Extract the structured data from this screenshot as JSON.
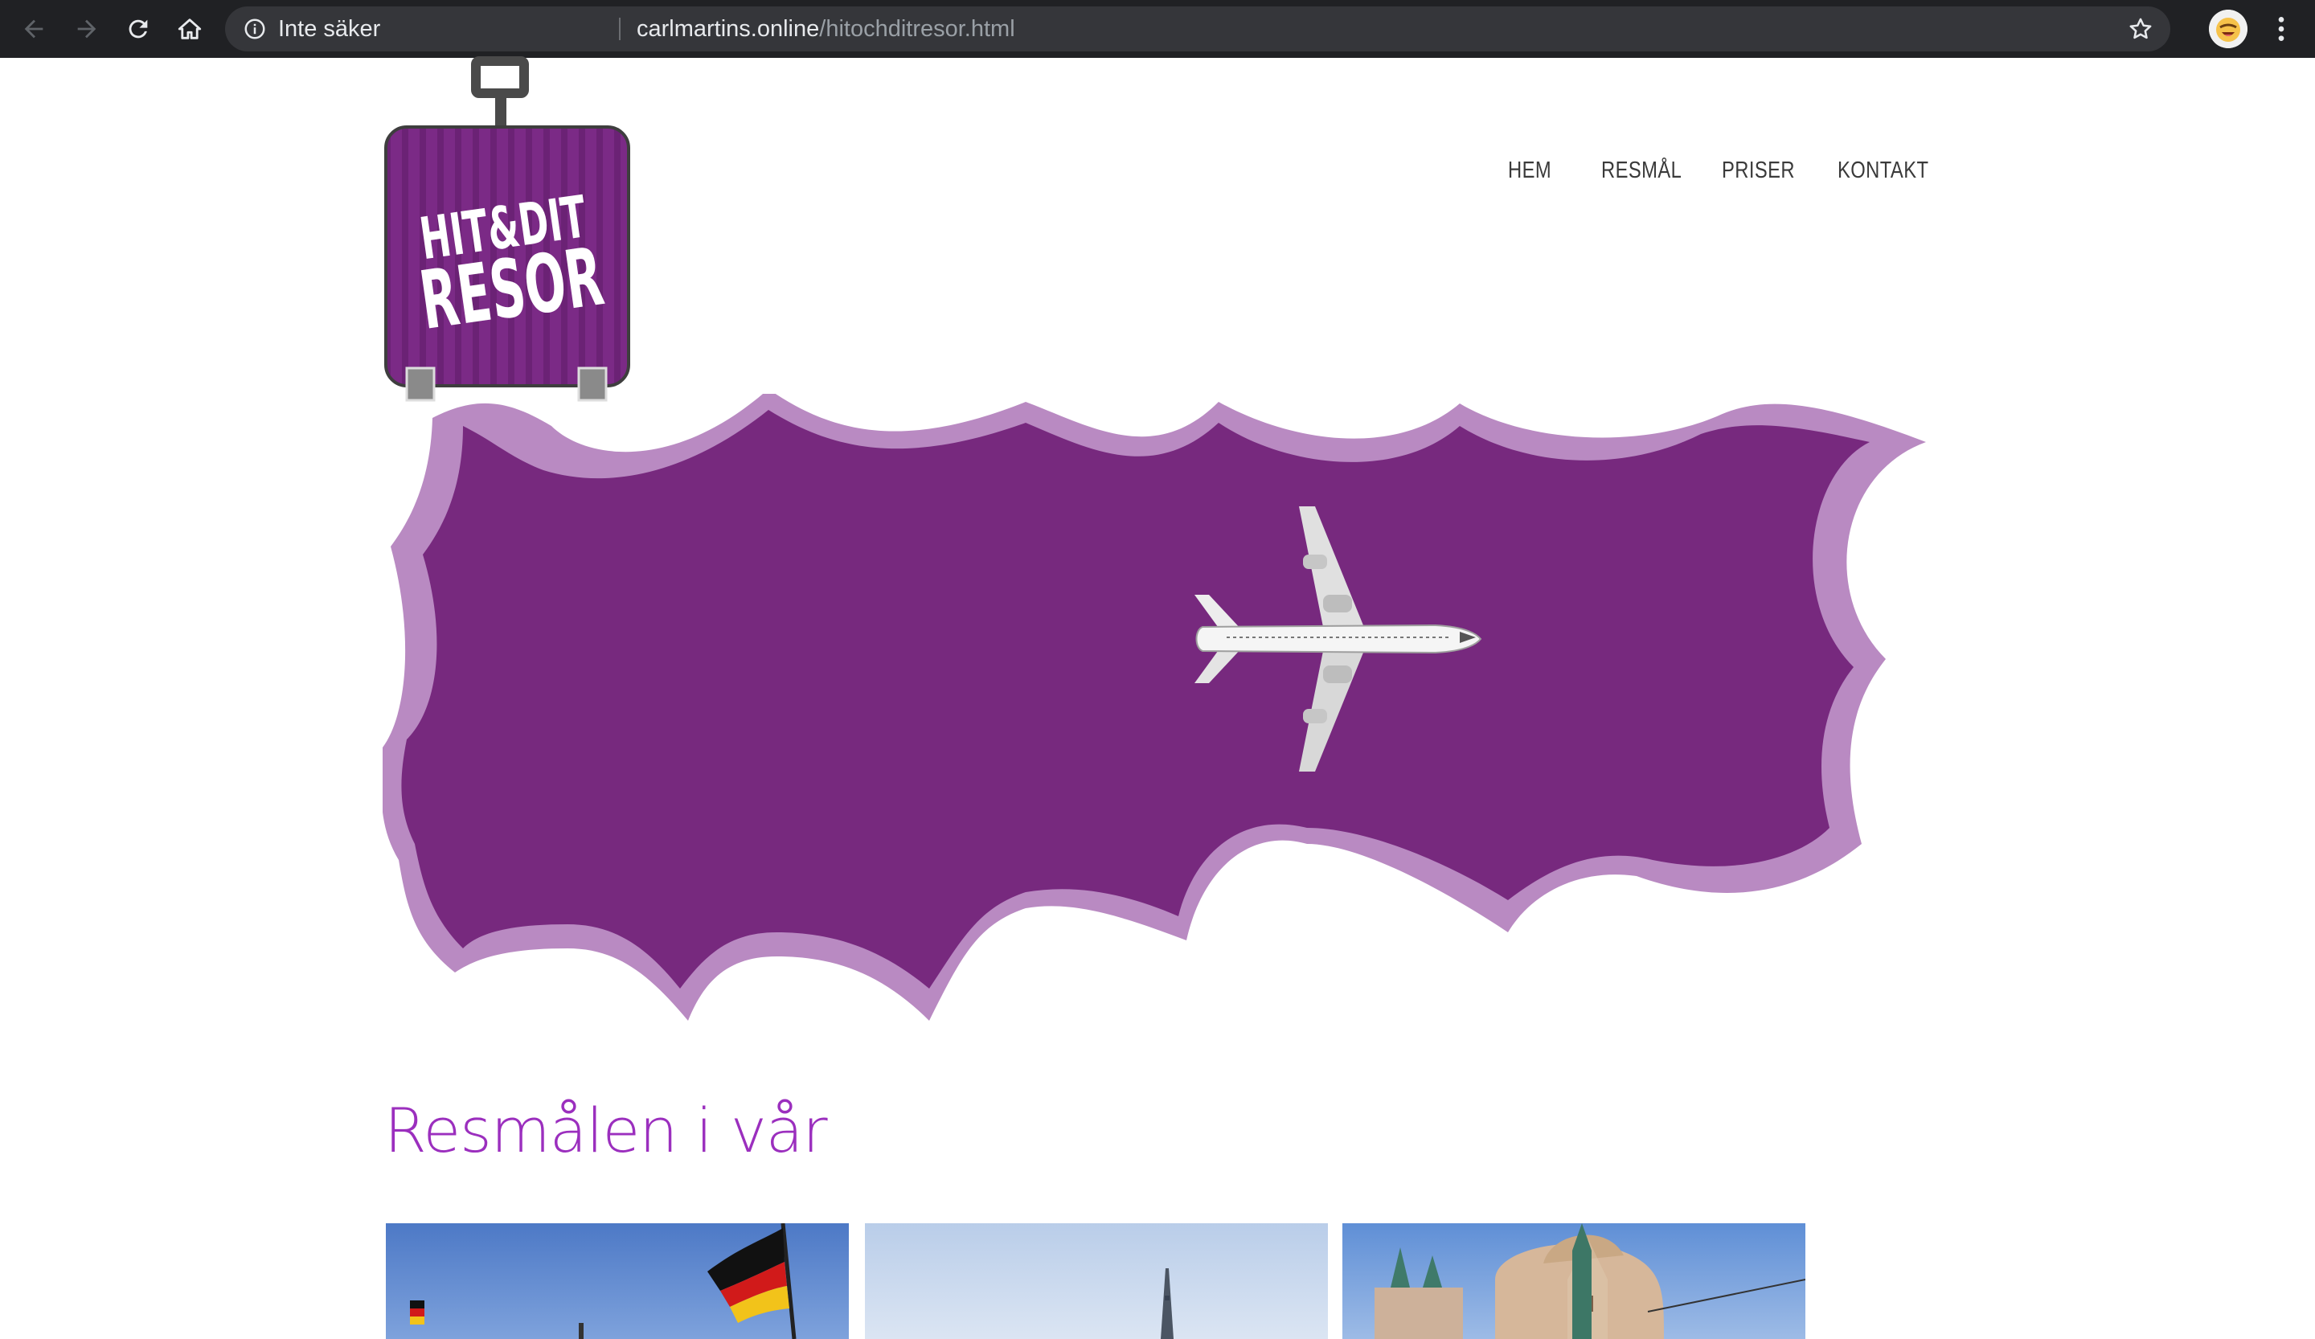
{
  "browser": {
    "security_label": "Inte säker",
    "url_domain": "carlmartins.online",
    "url_path": "/hitochditresor.html"
  },
  "logo": {
    "text_line1": "HIT&DIT",
    "text_line2": "RESOR",
    "color": "#7b2a86"
  },
  "nav": {
    "items": [
      {
        "label": "HEM"
      },
      {
        "label": "RESMÅL"
      },
      {
        "label": "PRISER"
      },
      {
        "label": "KONTAKT"
      }
    ]
  },
  "hero": {
    "cloud_color": "#77297e",
    "cloud_border_color": "#b98ac2"
  },
  "section": {
    "title": "Resmålen i vår",
    "title_color": "#9b2fbe"
  },
  "thumbnails": [
    {
      "subject": "german-flag-photo"
    },
    {
      "subject": "eiffel-tower-photo"
    },
    {
      "subject": "city-hall-photo"
    }
  ]
}
